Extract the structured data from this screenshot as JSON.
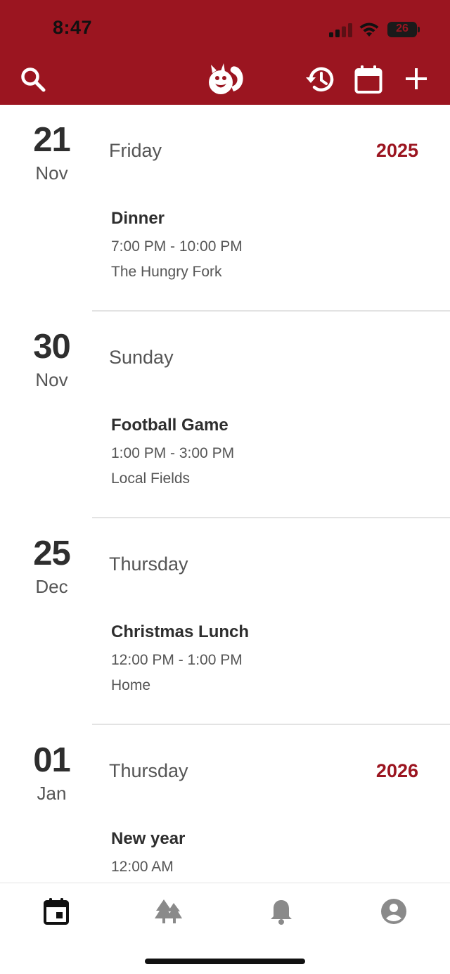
{
  "status_bar": {
    "time": "8:47",
    "battery": "26"
  },
  "header": {
    "icons": [
      "search-icon",
      "squirrel-logo-icon",
      "history-icon",
      "calendar-icon",
      "add-icon"
    ],
    "colors": {
      "brand": "#9B1520",
      "background": "#ffffff"
    }
  },
  "days": [
    {
      "day": "21",
      "month": "Nov",
      "weekday": "Friday",
      "year": "2025",
      "event": {
        "title": "Dinner",
        "time": "7:00 PM - 10:00 PM",
        "location": "The Hungry Fork"
      }
    },
    {
      "day": "30",
      "month": "Nov",
      "weekday": "Sunday",
      "year": "",
      "event": {
        "title": "Football Game",
        "time": "1:00 PM - 3:00 PM",
        "location": "Local Fields"
      }
    },
    {
      "day": "25",
      "month": "Dec",
      "weekday": "Thursday",
      "year": "",
      "event": {
        "title": "Christmas Lunch",
        "time": "12:00 PM - 1:00 PM",
        "location": "Home"
      }
    },
    {
      "day": "01",
      "month": "Jan",
      "weekday": "Thursday",
      "year": "2026",
      "event": {
        "title": "New year",
        "time": "12:00 AM",
        "location": ""
      }
    }
  ],
  "bottom_nav": {
    "items": [
      "calendar-tab-icon",
      "trees-tab-icon",
      "bell-tab-icon",
      "profile-tab-icon"
    ],
    "active": "calendar-tab-icon"
  }
}
